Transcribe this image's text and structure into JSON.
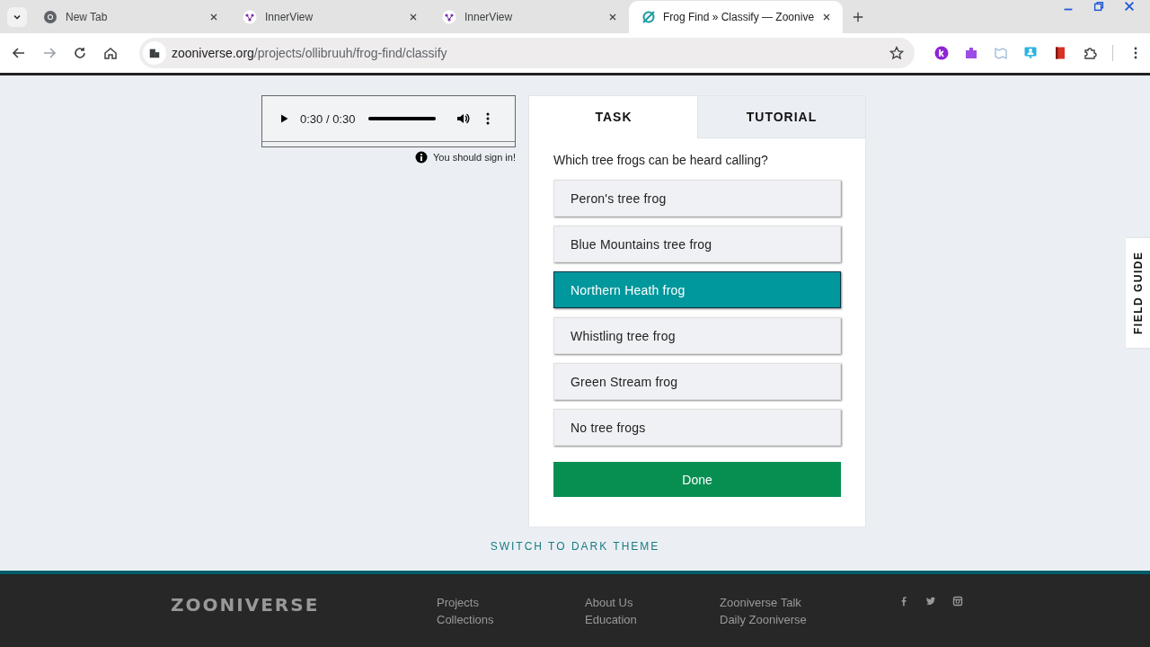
{
  "browser": {
    "tabs": [
      {
        "title": "New Tab",
        "kind": "chrome",
        "selected": false
      },
      {
        "title": "InnerView",
        "kind": "innerview",
        "selected": false
      },
      {
        "title": "InnerView",
        "kind": "innerview",
        "selected": false
      },
      {
        "title": "Frog Find » Classify — Zoonive",
        "kind": "zooniverse",
        "selected": true
      }
    ],
    "url_host": "zooniverse.org",
    "url_path": "/projects/ollibruuh/frog-find/classify"
  },
  "player": {
    "time": "0:30 / 0:30",
    "level": 1
  },
  "sign_in_note": "You should sign in!",
  "task_tabs": [
    {
      "label": "TASK",
      "selected": true
    },
    {
      "label": "TUTORIAL",
      "selected": false
    }
  ],
  "question": "Which tree frogs can be heard calling?",
  "answers": [
    {
      "label": "Peron's tree frog",
      "selected": false
    },
    {
      "label": "Blue Mountains tree frog",
      "selected": false
    },
    {
      "label": "Northern Heath frog",
      "selected": true
    },
    {
      "label": "Whistling tree frog",
      "selected": false
    },
    {
      "label": "Green Stream frog",
      "selected": false
    },
    {
      "label": "No tree frogs",
      "selected": false
    }
  ],
  "done_button": "Done",
  "field_guide": "FIELD GUIDE",
  "theme_link": "SWITCH TO DARK THEME",
  "footer": {
    "logo": "ZOONIVERSE",
    "columns": [
      [
        "Projects",
        "Collections"
      ],
      [
        "About Us",
        "Education"
      ],
      [
        "Zooniverse Talk",
        "Daily Zooniverse"
      ]
    ]
  }
}
